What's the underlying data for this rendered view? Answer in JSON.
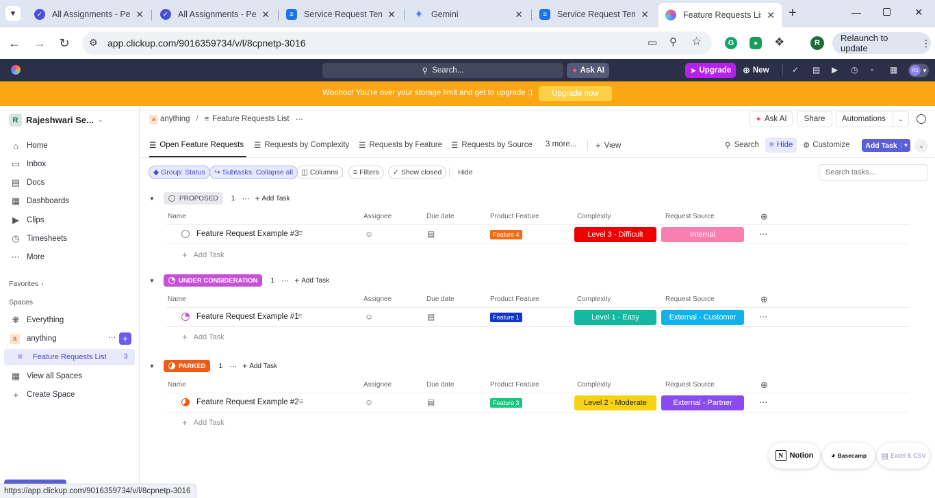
{
  "browser": {
    "tabs": [
      {
        "title": "All Assignments - Pep",
        "icon": "pepper-icon",
        "color": "#4b4fd8"
      },
      {
        "title": "All Assignments - Pep",
        "icon": "pepper-icon",
        "color": "#4b4fd8"
      },
      {
        "title": "Service Request Temp",
        "icon": "docs-icon",
        "color": "#1a73e8"
      },
      {
        "title": "Gemini",
        "icon": "gemini-icon",
        "color": "#4f7df3"
      },
      {
        "title": "Service Request Temp",
        "icon": "docs-icon",
        "color": "#1a73e8"
      },
      {
        "title": "Feature Requests List",
        "icon": "clickup-icon",
        "color": "#7b68ee"
      }
    ],
    "url": "app.clickup.com/9016359734/v/l/8cpnetp-3016",
    "profile_initial": "R",
    "relaunch_label": "Relaunch to update",
    "status_url": "https://app.clickup.com/9016359734/v/l/8cpnetp-3016"
  },
  "topbar": {
    "search_label": "Search...",
    "ask_ai_label": "Ask AI",
    "upgrade_label": "Upgrade",
    "new_label": "New",
    "avatar_initials": "RS"
  },
  "banner": {
    "text": "Woohoo! You're over your storage limit and get to upgrade :)",
    "button_label": "Upgrade now"
  },
  "sidebar": {
    "workspace_initial": "R",
    "workspace_name": "Rajeshwari Se...",
    "items": [
      {
        "label": "Home",
        "icon": "home-icon"
      },
      {
        "label": "Inbox",
        "icon": "inbox-icon"
      },
      {
        "label": "Docs",
        "icon": "docs-icon"
      },
      {
        "label": "Dashboards",
        "icon": "dashboards-icon"
      },
      {
        "label": "Clips",
        "icon": "clips-icon"
      },
      {
        "label": "Timesheets",
        "icon": "timesheets-icon"
      },
      {
        "label": "More",
        "icon": "more-icon"
      }
    ],
    "favorites_label": "Favorites",
    "spaces_label": "Spaces",
    "everything_label": "Everything",
    "space_initial": "a",
    "space_name": "anything",
    "list_name": "Feature Requests List",
    "list_count": "3",
    "view_all_spaces_label": "View all Spaces",
    "create_space_label": "Create Space"
  },
  "header": {
    "crumb_space_initial": "a",
    "crumb_space": "anything",
    "crumb_list": "Feature Requests List",
    "ask_ai_label": "Ask AI",
    "share_label": "Share",
    "automations_label": "Automations"
  },
  "views": {
    "tabs": [
      "Open Feature Requests",
      "Requests by Complexity",
      "Requests by Feature",
      "Requests by Source"
    ],
    "more_label": "3 more...",
    "add_view_label": "View",
    "search_label": "Search",
    "hide_label": "Hide",
    "customize_label": "Customize",
    "add_task_label": "Add Task"
  },
  "toolbar": {
    "group_label": "Group: Status",
    "subtasks_label": "Subtasks: Collapse all",
    "columns_label": "Columns",
    "filters_label": "Filters",
    "show_closed_label": "Show closed",
    "hide_label": "Hide",
    "search_placeholder": "Search tasks..."
  },
  "columns": [
    "Name",
    "Assignee",
    "Due date",
    "Product Feature",
    "Complexity",
    "Request Source"
  ],
  "groups": [
    {
      "status": "PROPOSED",
      "count": "1",
      "add_label": "Add Task",
      "badge_bg": "#e8e8ee",
      "badge_fg": "#4b4f5c",
      "task": {
        "name": "Feature Request Example #3",
        "feature": "Feature 4",
        "feature_color": "#f46a12",
        "complexity": "Level 3 - Difficult",
        "complexity_color": "#ee0000",
        "source": "Internal",
        "source_color": "#f97fb0"
      },
      "add_task_label": "Add Task"
    },
    {
      "status": "UNDER CONSIDERATION",
      "count": "1",
      "add_label": "Add Task",
      "badge_bg": "#c84fd8",
      "badge_fg": "#ffffff",
      "task": {
        "name": "Feature Request Example #1",
        "feature": "Feature 1",
        "feature_color": "#1037c9",
        "complexity": "Level 1 - Easy",
        "complexity_color": "#14b8a0",
        "source": "External - Customer",
        "source_color": "#0fb3ea"
      },
      "add_task_label": "Add Task"
    },
    {
      "status": "PARKED",
      "count": "1",
      "add_label": "Add Task",
      "badge_bg": "#f05a14",
      "badge_fg": "#ffffff",
      "task": {
        "name": "Feature Request Example #2",
        "feature": "Feature 3",
        "feature_color": "#1dc57e",
        "complexity": "Level 2 - Moderate",
        "complexity_color": "#f7d314",
        "source": "External - Partner",
        "source_color": "#8a4cf0"
      },
      "add_task_label": "Add Task"
    }
  ],
  "imports": {
    "notion_label": "Notion",
    "basecamp_label": "Basecamp",
    "excel_label": "Excel & CSV"
  }
}
